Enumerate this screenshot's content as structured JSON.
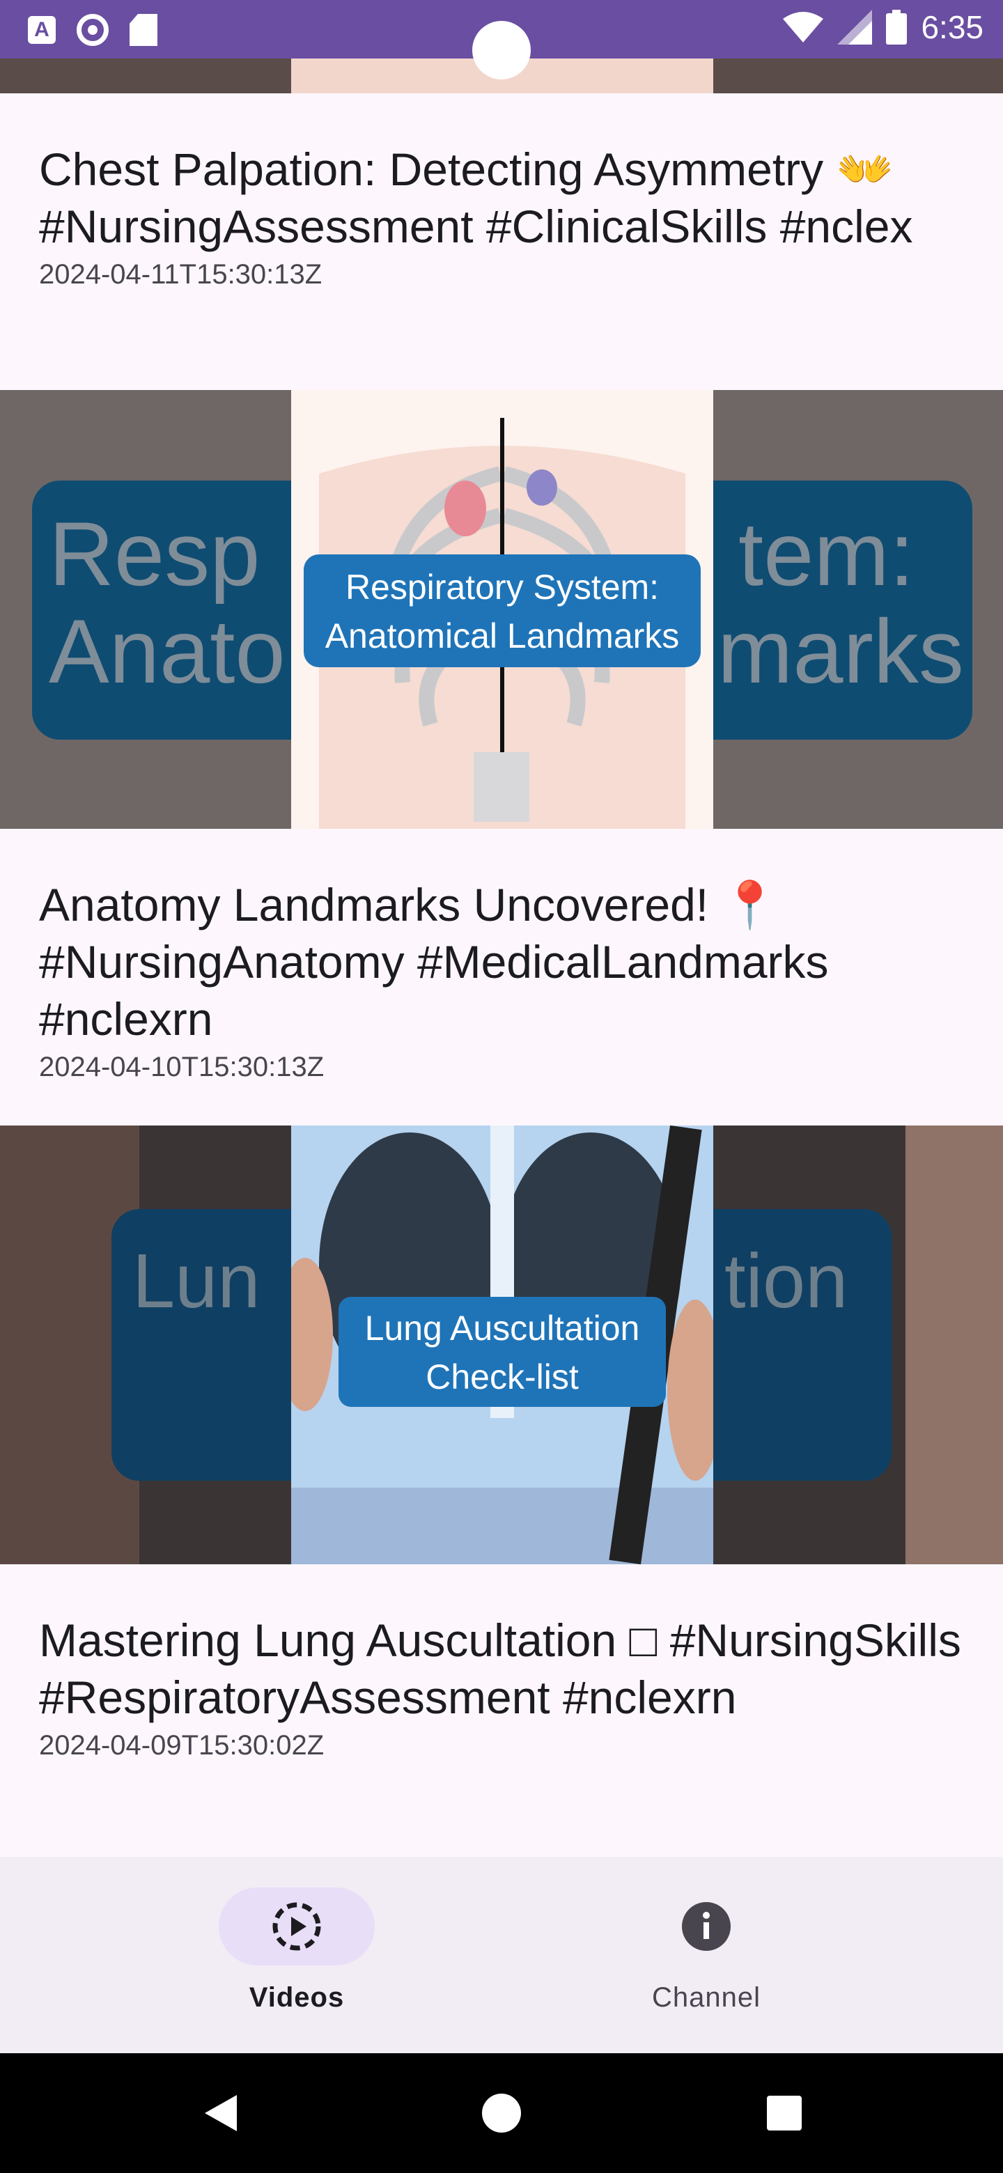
{
  "status_bar": {
    "time": "6:35",
    "icons": [
      "text-a-icon",
      "circle-app-icon",
      "sd-card-icon",
      "wifi-icon",
      "signal-icon",
      "battery-icon"
    ]
  },
  "videos": [
    {
      "title": "Chest Palpation: Detecting Asymmetry 👐 #NursingAssessment #ClinicalSkills #nclex",
      "date": "2024-04-11T15:30:13Z"
    },
    {
      "thumbnail_caption": "Respiratory System: Anatomical Landmarks",
      "thumbnail_bg_left": "Resp",
      "thumbnail_bg_right": "tem:",
      "thumbnail_bg_left2": "Anato",
      "thumbnail_bg_right2": "marks",
      "title": "Anatomy Landmarks Uncovered! 📍 #NursingAnatomy #MedicalLandmarks #nclexrn",
      "date": "2024-04-10T15:30:13Z"
    },
    {
      "thumbnail_caption": "Lung Auscultation Check-list",
      "thumbnail_bg_left": "Lun",
      "thumbnail_bg_right": "tion",
      "title": "Mastering Lung Auscultation □ #NursingSkills #RespiratoryAssessment #nclexrn",
      "date": "2024-04-09T15:30:02Z"
    }
  ],
  "bottom_nav": {
    "items": [
      {
        "label": "Videos",
        "icon": "play-circle-icon",
        "active": true
      },
      {
        "label": "Channel",
        "icon": "info-icon",
        "active": false
      }
    ]
  },
  "colors": {
    "status_bar": "#6a4ea1",
    "background": "#fdf7fd",
    "nav_bg": "#f2ecf5",
    "active_pill": "#e8def8",
    "thumb_caption_bg": "#1f74b8"
  }
}
